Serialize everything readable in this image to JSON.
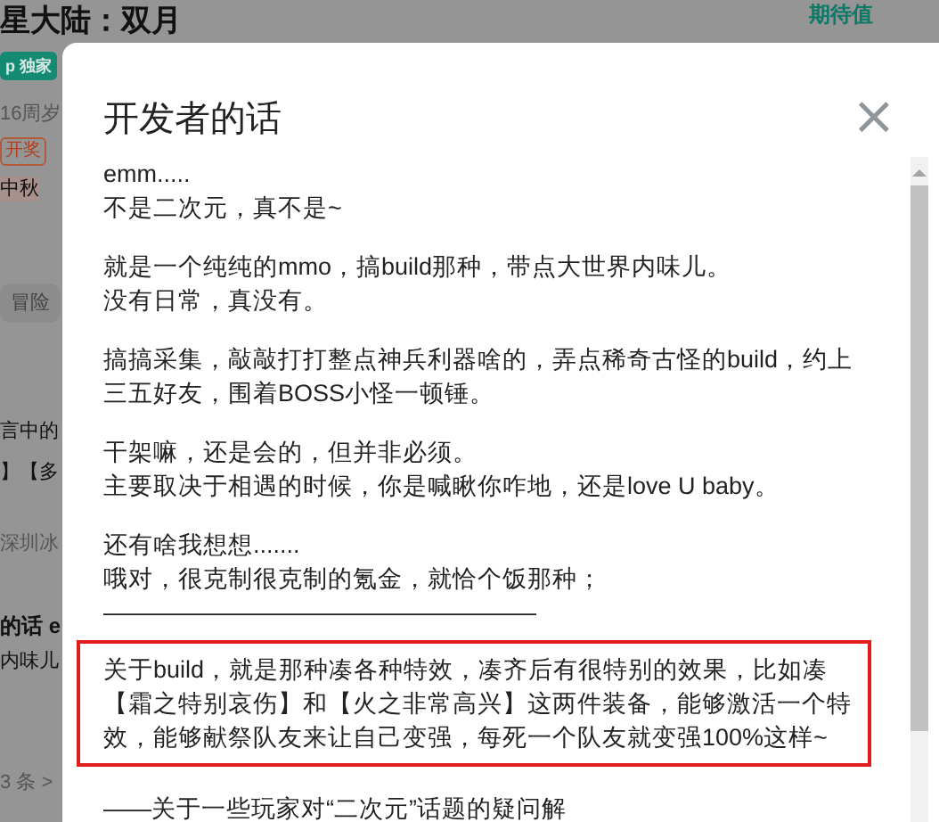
{
  "page": {
    "title": "星大陆：双月",
    "score_label": "期待值",
    "side_items": [
      {
        "kind": "badge",
        "text": "p 独家"
      },
      {
        "kind": "meta",
        "text": "16周岁"
      },
      {
        "kind": "tag",
        "text": "开奖"
      },
      {
        "kind": "line",
        "text": "中秋"
      },
      {
        "kind": "chip",
        "text": "冒险"
      },
      {
        "kind": "line",
        "text": "言中的"
      },
      {
        "kind": "line",
        "text": "】【多"
      },
      {
        "kind": "meta",
        "text": "深圳冰"
      },
      {
        "kind": "bold",
        "text": "的话 e"
      },
      {
        "kind": "line",
        "text": "内味儿"
      },
      {
        "kind": "meta",
        "text": "3 条 >"
      }
    ]
  },
  "dialog": {
    "title": "开发者的话",
    "close": "×",
    "paragraphs": [
      {
        "kind": "text",
        "lines": [
          "emm.....",
          "不是二次元，真不是~"
        ]
      },
      {
        "kind": "text",
        "lines": [
          "就是一个纯纯的mmo，搞build那种，带点大世界内味儿。",
          "没有日常，真没有。"
        ]
      },
      {
        "kind": "text",
        "lines": [
          "搞搞采集，敲敲打打整点神兵利器啥的，弄点稀奇古怪的build，约上三五好友，围着BOSS小怪一顿锤。"
        ]
      },
      {
        "kind": "text",
        "lines": [
          "干架嘛，还是会的，但并非必须。",
          "主要取决于相遇的时候，你是喊瞅你咋地，还是love U baby。"
        ]
      },
      {
        "kind": "text",
        "lines": [
          "还有啥我想想.......",
          "哦对，很克制很克制的氪金，就恰个饭那种；",
          "——————————————————"
        ]
      },
      {
        "kind": "highlight",
        "lines": [
          "关于build，就是那种凑各种特效，凑齐后有很特别的效果，比如凑【霜之特别哀伤】和【火之非常高兴】这两件装备，能够激活一个特效，能够献祭队友来让自己变强，每死一个队友就变强100%这样~"
        ]
      },
      {
        "kind": "text",
        "lines": [
          "——关于一些玩家对“二次元”话题的疑问解"
        ]
      }
    ]
  }
}
